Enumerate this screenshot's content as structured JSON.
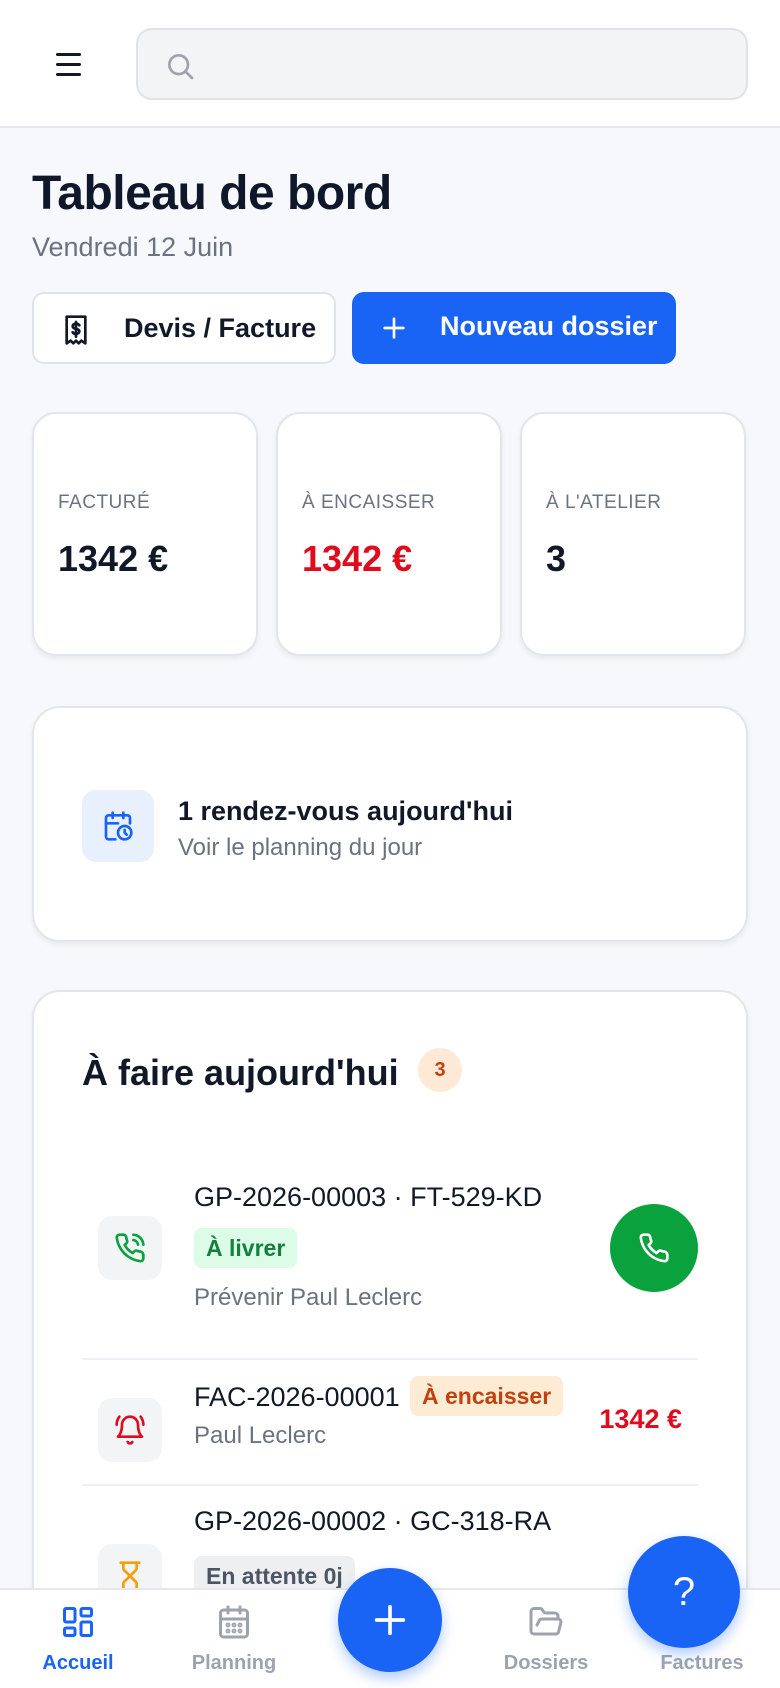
{
  "header": {
    "search_placeholder": "",
    "search_value": ""
  },
  "page": {
    "title": "Tableau de bord",
    "date": "Vendredi 12 Juin"
  },
  "actions": {
    "secondary_label": "Devis / Facture",
    "primary_label": "Nouveau dossier"
  },
  "stats": [
    {
      "label": "FACTURÉ",
      "value": "1342 €"
    },
    {
      "label": "À ENCAISSER",
      "value": "1342 €"
    },
    {
      "label": "À L'ATELIER",
      "value": "3"
    }
  ],
  "appointment": {
    "title": "1 rendez-vous aujourd'hui",
    "subtitle": "Voir le planning du jour"
  },
  "todo": {
    "title": "À faire aujourd'hui",
    "count": "3",
    "items": [
      {
        "ref": "GP-2026-00003 · FT-529-KD",
        "badge": "À livrer",
        "sub": "Prévenir Paul Leclerc",
        "icon": "phone-call-icon"
      },
      {
        "ref": "FAC-2026-00001",
        "badge": "À encaisser",
        "sub": "Paul Leclerc",
        "amount": "1342 €",
        "icon": "bell-icon"
      },
      {
        "ref": "GP-2026-00002 · GC-318-RA",
        "badge": "En attente 0j",
        "icon": "hourglass-icon"
      }
    ]
  },
  "nav": [
    {
      "label": "Accueil",
      "icon": "dashboard-icon",
      "active": true
    },
    {
      "label": "Planning",
      "icon": "calendar-icon",
      "active": false
    },
    {
      "label": "Dossiers",
      "icon": "folder-icon",
      "active": false
    },
    {
      "label": "Factures",
      "icon": "invoice-icon",
      "active": false
    }
  ],
  "help_label": "?",
  "colors": {
    "primary": "#1963f5",
    "danger": "#e00b1c",
    "success": "#0aa23d"
  }
}
